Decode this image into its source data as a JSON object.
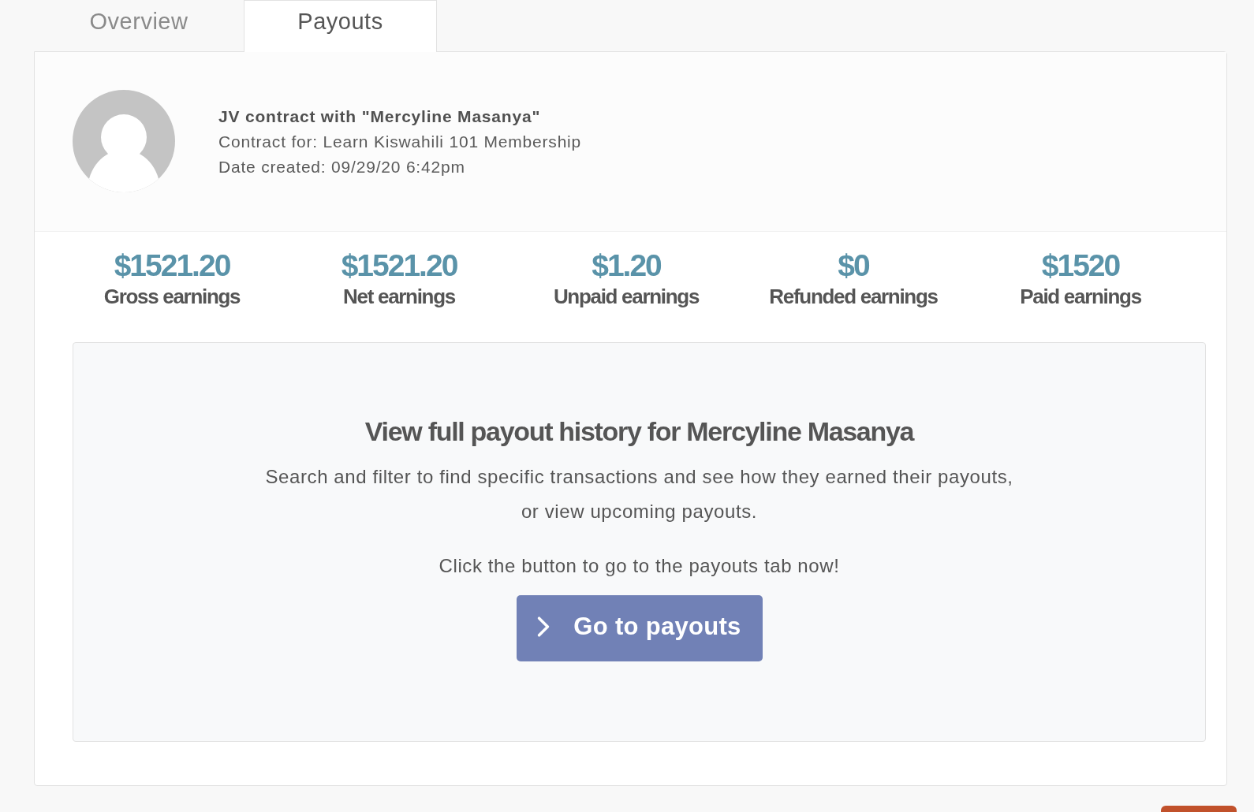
{
  "tabs": [
    {
      "label": "Overview",
      "selected": false
    },
    {
      "label": "Payouts",
      "selected": true
    }
  ],
  "contract": {
    "title": "JV contract with \"Mercyline Masanya\"",
    "contract_for": "Contract for: Learn Kiswahili 101 Membership",
    "date_created": "Date created: 09/29/20 6:42pm"
  },
  "stats": [
    {
      "value": "$1521.20",
      "label": "Gross earnings"
    },
    {
      "value": "$1521.20",
      "label": "Net earnings"
    },
    {
      "value": "$1.20",
      "label": "Unpaid earnings"
    },
    {
      "value": "$0",
      "label": "Refunded earnings"
    },
    {
      "value": "$1520",
      "label": "Paid earnings"
    }
  ],
  "history": {
    "heading": "View full payout history for Mercyline Masanya",
    "description": "Search and filter to find specific transactions and see how they earned their payouts, or view upcoming payouts.",
    "prompt": "Click the button to go to the payouts tab now!",
    "button": "Go to payouts"
  }
}
